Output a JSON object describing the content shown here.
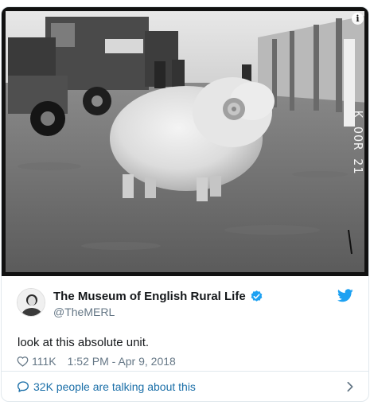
{
  "tweet": {
    "display_name": "The Museum of English Rural Life",
    "handle": "@TheMERL",
    "text": "look at this absolute unit.",
    "likes": "111K",
    "timestamp": "1:52 PM - Apr 9, 2018",
    "media": {
      "info_icon": "info-icon",
      "negative_mark": "K OOR 21"
    }
  },
  "footer": {
    "talking_label": "32K people are talking about this"
  },
  "icons": {
    "verified": "verified-badge-icon",
    "brand": "twitter-bird-icon",
    "like": "heart-icon",
    "reply": "speech-bubble-icon",
    "more": "chevron-right-icon"
  },
  "colors": {
    "brand_blue": "#1da1f2",
    "link_blue": "#1b6fa8",
    "secondary_text": "#657786",
    "border": "#e1e8ed"
  }
}
